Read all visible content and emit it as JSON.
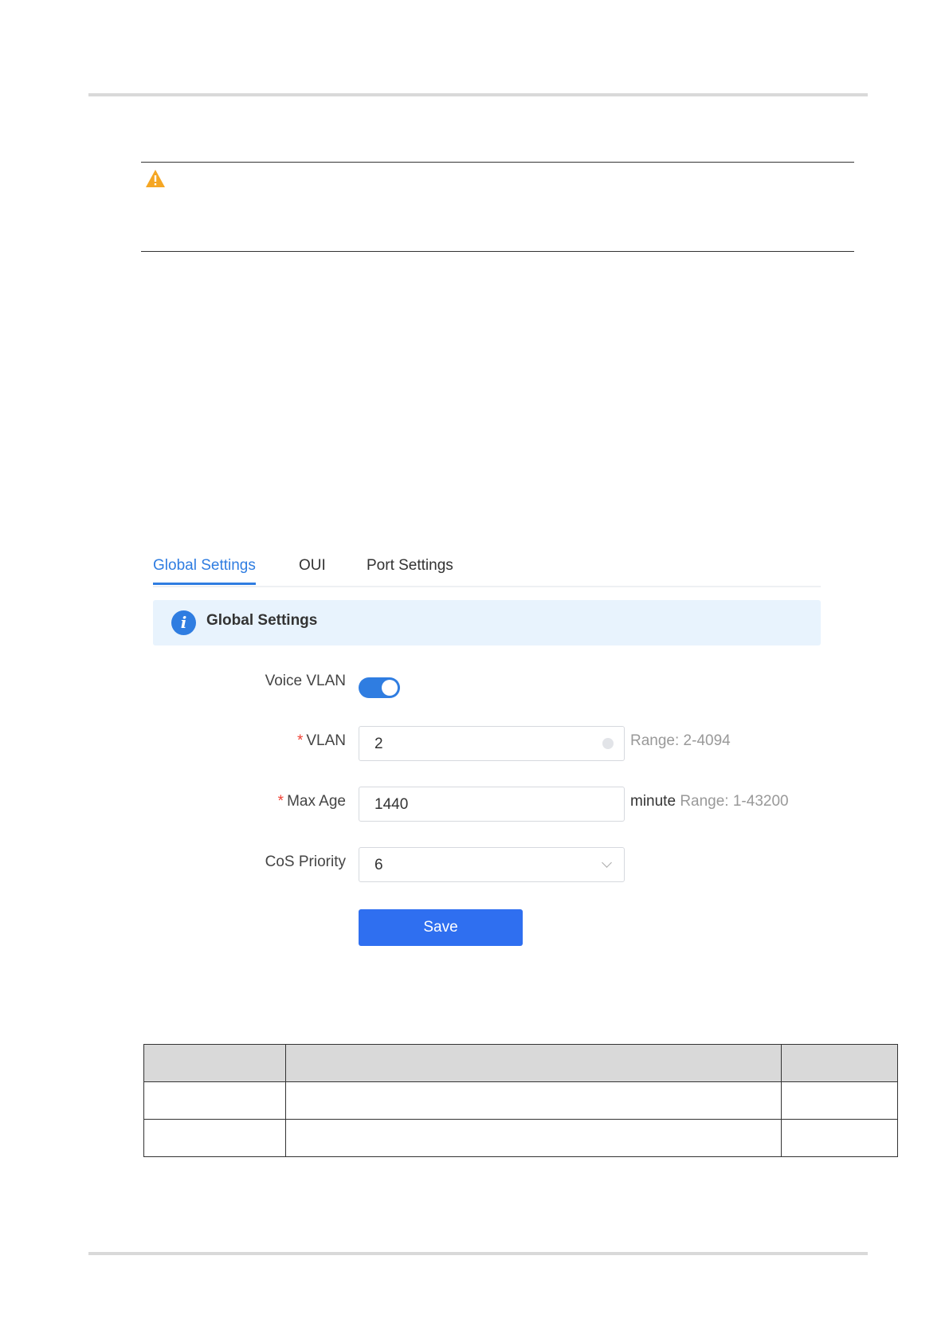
{
  "tabs": [
    "Global Settings",
    "OUI",
    "Port Settings"
  ],
  "info_title": "Global Settings",
  "form": {
    "voice_vlan_label": "Voice VLAN",
    "voice_vlan_enabled": true,
    "vlan_label": "VLAN",
    "vlan_value": "2",
    "vlan_hint": "Range: 2-4094",
    "max_age_label": "Max Age",
    "max_age_value": "1440",
    "max_age_unit": "minute",
    "max_age_hint": "Range: 1-43200",
    "cos_label": "CoS Priority",
    "cos_value": "6",
    "required_mark": "*",
    "save_label": "Save"
  },
  "icons": {
    "warning": "warning-triangle-icon",
    "info": "info-icon",
    "clear": "clear-icon",
    "dropdown": "chevron-down-icon"
  },
  "colors": {
    "accent": "#2f7de1",
    "button": "#2f6ff0",
    "info_bg": "#e8f3fd",
    "required": "#f04134",
    "warning": "#f5a623"
  }
}
